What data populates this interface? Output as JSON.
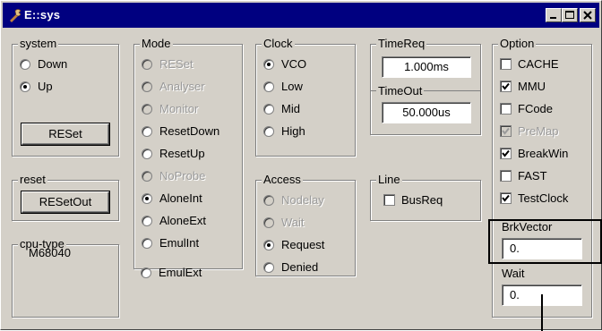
{
  "window": {
    "title": "E::sys"
  },
  "system": {
    "label": "system",
    "options": [
      "Down",
      "Up"
    ],
    "selected": "Up",
    "button": "RESet"
  },
  "reset": {
    "label": "reset",
    "button": "RESetOut"
  },
  "cpu_type": {
    "label": "cpu-type",
    "value": "M68040"
  },
  "mode": {
    "label": "Mode",
    "options": [
      {
        "label": "RESet",
        "disabled": true
      },
      {
        "label": "Analyser",
        "disabled": true
      },
      {
        "label": "Monitor",
        "disabled": true
      },
      {
        "label": "ResetDown",
        "disabled": false
      },
      {
        "label": "ResetUp",
        "disabled": false
      },
      {
        "label": "NoProbe",
        "disabled": true
      },
      {
        "label": "AloneInt",
        "disabled": false
      },
      {
        "label": "AloneExt",
        "disabled": false
      },
      {
        "label": "EmulInt",
        "disabled": false
      },
      {
        "label": "EmulExt",
        "disabled": false
      }
    ],
    "selected": "AloneInt"
  },
  "clock": {
    "label": "Clock",
    "options": [
      "VCO",
      "Low",
      "Mid",
      "High"
    ],
    "selected": "VCO"
  },
  "access": {
    "label": "Access",
    "options": [
      {
        "label": "Nodelay",
        "disabled": true
      },
      {
        "label": "Wait",
        "disabled": true
      },
      {
        "label": "Request",
        "disabled": false
      },
      {
        "label": "Denied",
        "disabled": false
      }
    ],
    "selected": "Request"
  },
  "timereq": {
    "label": "TimeReq",
    "value": "1.000ms"
  },
  "timeout": {
    "label": "TimeOut",
    "value": "50.000us"
  },
  "line": {
    "label": "Line",
    "busreq_label": "BusReq",
    "busreq_checked": false
  },
  "option": {
    "label": "Option",
    "items": [
      {
        "label": "CACHE",
        "checked": false,
        "disabled": false
      },
      {
        "label": "MMU",
        "checked": true,
        "disabled": false
      },
      {
        "label": "FCode",
        "checked": false,
        "disabled": false
      },
      {
        "label": "PreMap",
        "checked": true,
        "disabled": true
      },
      {
        "label": "BreakWin",
        "checked": true,
        "disabled": false
      },
      {
        "label": "FAST",
        "checked": false,
        "disabled": false
      },
      {
        "label": "TestClock",
        "checked": true,
        "disabled": false
      }
    ]
  },
  "brkvector": {
    "label": "BrkVector",
    "value": "0."
  },
  "wait": {
    "label": "Wait",
    "value": "0."
  }
}
